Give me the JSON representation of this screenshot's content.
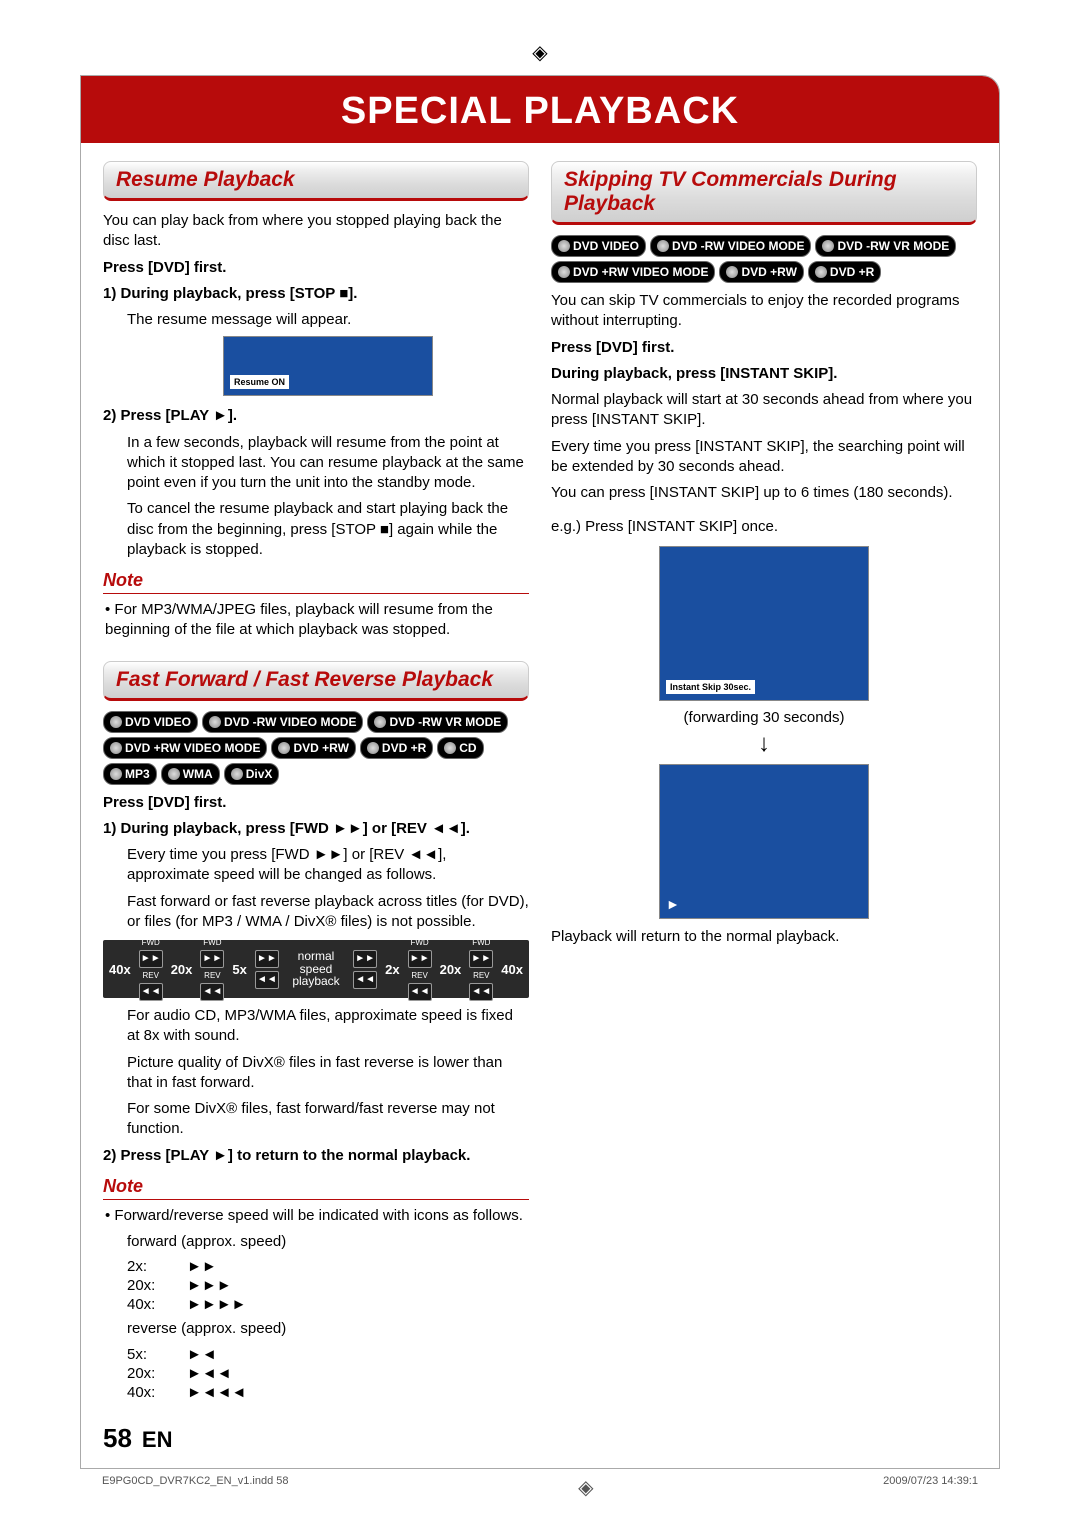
{
  "page": {
    "title": "SPECIAL PLAYBACK",
    "number": "58",
    "lang": "EN",
    "foot_left": "E9PG0CD_DVR7KC2_EN_v1.indd   58",
    "foot_right": "2009/07/23   14:39:1"
  },
  "left": {
    "resume": {
      "heading": "Resume Playback",
      "intro": "You can play back from where you stopped playing back the disc last.",
      "press_dvd": "Press [DVD] first.",
      "step1_title": "1) During playback, press [STOP ■].",
      "step1_body": "The resume message will appear.",
      "resume_on": "Resume ON",
      "step2_title": "2) Press [PLAY ►].",
      "step2_body1": "In a few seconds, playback will resume from the point at which it stopped last. You can resume playback at the same point even if you turn the unit into the standby mode.",
      "step2_body2": "To cancel the resume playback and start playing back the disc from the beginning, press [STOP ■] again while the playback is stopped.",
      "note_head": "Note",
      "note_body": "• For MP3/WMA/JPEG files, playback will resume from the beginning of the file at which playback was stopped."
    },
    "ffrev": {
      "heading": "Fast Forward / Fast Reverse Playback",
      "badges": [
        "DVD VIDEO",
        "DVD -RW VIDEO MODE",
        "DVD -RW VR MODE",
        "DVD +RW VIDEO MODE",
        "DVD +RW",
        "DVD +R",
        "CD",
        "MP3",
        "WMA",
        "DivX"
      ],
      "press_dvd": "Press [DVD] first.",
      "step1_title": "1) During playback, press [FWD ►►] or [REV ◄◄].",
      "step1_body1": "Every time you press [FWD ►►] or [REV ◄◄], approximate speed will be changed as follows.",
      "step1_body2": "Fast forward or fast reverse playback across titles (for DVD), or files (for MP3 / WMA / DivX® files) is not possible.",
      "speed_strip": {
        "left": [
          "40x",
          "20x",
          "5x"
        ],
        "center": "normal speed playback",
        "right": [
          "2x",
          "20x",
          "40x"
        ],
        "fwd": "FWD",
        "rev": "REV"
      },
      "after1": "For audio CD, MP3/WMA files, approximate speed is fixed at 8x with sound.",
      "after2": "Picture quality of DivX® files in fast reverse is lower than that in fast forward.",
      "after3": "For some DivX® files, fast forward/fast reverse may not function.",
      "step2_title": "2) Press [PLAY ►] to return to the normal playback.",
      "note_head": "Note",
      "note_intro": "• Forward/reverse speed will be indicated with icons as follows.",
      "fwd_label": "forward (approx. speed)",
      "fwd_rows": [
        {
          "lbl": "2x:",
          "ic": "►►"
        },
        {
          "lbl": "20x:",
          "ic": "►►►"
        },
        {
          "lbl": "40x:",
          "ic": "►►►►"
        }
      ],
      "rev_label": "reverse (approx. speed)",
      "rev_rows": [
        {
          "lbl": "5x:",
          "ic": "►◄"
        },
        {
          "lbl": "20x:",
          "ic": "►◄◄"
        },
        {
          "lbl": "40x:",
          "ic": "►◄◄◄"
        }
      ]
    }
  },
  "right": {
    "skip": {
      "heading": "Skipping TV Commercials During Playback",
      "badges": [
        "DVD VIDEO",
        "DVD -RW VIDEO MODE",
        "DVD -RW VR MODE",
        "DVD +RW VIDEO MODE",
        "DVD +RW",
        "DVD +R"
      ],
      "intro": "You can skip TV commercials to enjoy the recorded programs without interrupting.",
      "press_dvd": "Press [DVD] first.",
      "during_title": "During playback, press [INSTANT SKIP].",
      "body1": "Normal playback will start at 30 seconds ahead from where you press [INSTANT SKIP].",
      "body2": "Every time you press [INSTANT SKIP], the searching point will be extended by 30 seconds ahead.",
      "body3": "You can press [INSTANT SKIP] up to 6 times (180 seconds).",
      "eg_label": "e.g.) Press [INSTANT SKIP] once.",
      "img1_tag": "Instant Skip 30sec.",
      "caption1": "(forwarding 30 seconds)",
      "arrow": "↓",
      "play_icon": "►",
      "final": "Playback will return to the normal playback."
    }
  }
}
